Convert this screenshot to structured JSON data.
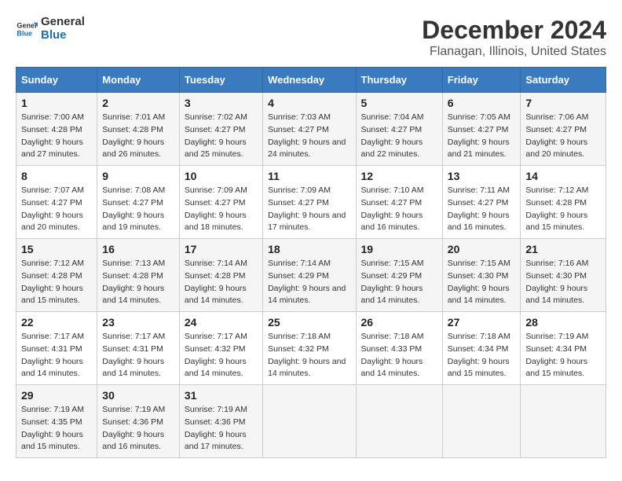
{
  "logo": {
    "line1": "General",
    "line2": "Blue"
  },
  "title": "December 2024",
  "subtitle": "Flanagan, Illinois, United States",
  "header_colors": {
    "bg": "#3a7abf",
    "text": "#ffffff"
  },
  "weekdays": [
    "Sunday",
    "Monday",
    "Tuesday",
    "Wednesday",
    "Thursday",
    "Friday",
    "Saturday"
  ],
  "weeks": [
    [
      {
        "day": "1",
        "sunrise": "Sunrise: 7:00 AM",
        "sunset": "Sunset: 4:28 PM",
        "daylight": "Daylight: 9 hours and 27 minutes."
      },
      {
        "day": "2",
        "sunrise": "Sunrise: 7:01 AM",
        "sunset": "Sunset: 4:28 PM",
        "daylight": "Daylight: 9 hours and 26 minutes."
      },
      {
        "day": "3",
        "sunrise": "Sunrise: 7:02 AM",
        "sunset": "Sunset: 4:27 PM",
        "daylight": "Daylight: 9 hours and 25 minutes."
      },
      {
        "day": "4",
        "sunrise": "Sunrise: 7:03 AM",
        "sunset": "Sunset: 4:27 PM",
        "daylight": "Daylight: 9 hours and 24 minutes."
      },
      {
        "day": "5",
        "sunrise": "Sunrise: 7:04 AM",
        "sunset": "Sunset: 4:27 PM",
        "daylight": "Daylight: 9 hours and 22 minutes."
      },
      {
        "day": "6",
        "sunrise": "Sunrise: 7:05 AM",
        "sunset": "Sunset: 4:27 PM",
        "daylight": "Daylight: 9 hours and 21 minutes."
      },
      {
        "day": "7",
        "sunrise": "Sunrise: 7:06 AM",
        "sunset": "Sunset: 4:27 PM",
        "daylight": "Daylight: 9 hours and 20 minutes."
      }
    ],
    [
      {
        "day": "8",
        "sunrise": "Sunrise: 7:07 AM",
        "sunset": "Sunset: 4:27 PM",
        "daylight": "Daylight: 9 hours and 20 minutes."
      },
      {
        "day": "9",
        "sunrise": "Sunrise: 7:08 AM",
        "sunset": "Sunset: 4:27 PM",
        "daylight": "Daylight: 9 hours and 19 minutes."
      },
      {
        "day": "10",
        "sunrise": "Sunrise: 7:09 AM",
        "sunset": "Sunset: 4:27 PM",
        "daylight": "Daylight: 9 hours and 18 minutes."
      },
      {
        "day": "11",
        "sunrise": "Sunrise: 7:09 AM",
        "sunset": "Sunset: 4:27 PM",
        "daylight": "Daylight: 9 hours and 17 minutes."
      },
      {
        "day": "12",
        "sunrise": "Sunrise: 7:10 AM",
        "sunset": "Sunset: 4:27 PM",
        "daylight": "Daylight: 9 hours and 16 minutes."
      },
      {
        "day": "13",
        "sunrise": "Sunrise: 7:11 AM",
        "sunset": "Sunset: 4:27 PM",
        "daylight": "Daylight: 9 hours and 16 minutes."
      },
      {
        "day": "14",
        "sunrise": "Sunrise: 7:12 AM",
        "sunset": "Sunset: 4:28 PM",
        "daylight": "Daylight: 9 hours and 15 minutes."
      }
    ],
    [
      {
        "day": "15",
        "sunrise": "Sunrise: 7:12 AM",
        "sunset": "Sunset: 4:28 PM",
        "daylight": "Daylight: 9 hours and 15 minutes."
      },
      {
        "day": "16",
        "sunrise": "Sunrise: 7:13 AM",
        "sunset": "Sunset: 4:28 PM",
        "daylight": "Daylight: 9 hours and 14 minutes."
      },
      {
        "day": "17",
        "sunrise": "Sunrise: 7:14 AM",
        "sunset": "Sunset: 4:28 PM",
        "daylight": "Daylight: 9 hours and 14 minutes."
      },
      {
        "day": "18",
        "sunrise": "Sunrise: 7:14 AM",
        "sunset": "Sunset: 4:29 PM",
        "daylight": "Daylight: 9 hours and 14 minutes."
      },
      {
        "day": "19",
        "sunrise": "Sunrise: 7:15 AM",
        "sunset": "Sunset: 4:29 PM",
        "daylight": "Daylight: 9 hours and 14 minutes."
      },
      {
        "day": "20",
        "sunrise": "Sunrise: 7:15 AM",
        "sunset": "Sunset: 4:30 PM",
        "daylight": "Daylight: 9 hours and 14 minutes."
      },
      {
        "day": "21",
        "sunrise": "Sunrise: 7:16 AM",
        "sunset": "Sunset: 4:30 PM",
        "daylight": "Daylight: 9 hours and 14 minutes."
      }
    ],
    [
      {
        "day": "22",
        "sunrise": "Sunrise: 7:17 AM",
        "sunset": "Sunset: 4:31 PM",
        "daylight": "Daylight: 9 hours and 14 minutes."
      },
      {
        "day": "23",
        "sunrise": "Sunrise: 7:17 AM",
        "sunset": "Sunset: 4:31 PM",
        "daylight": "Daylight: 9 hours and 14 minutes."
      },
      {
        "day": "24",
        "sunrise": "Sunrise: 7:17 AM",
        "sunset": "Sunset: 4:32 PM",
        "daylight": "Daylight: 9 hours and 14 minutes."
      },
      {
        "day": "25",
        "sunrise": "Sunrise: 7:18 AM",
        "sunset": "Sunset: 4:32 PM",
        "daylight": "Daylight: 9 hours and 14 minutes."
      },
      {
        "day": "26",
        "sunrise": "Sunrise: 7:18 AM",
        "sunset": "Sunset: 4:33 PM",
        "daylight": "Daylight: 9 hours and 14 minutes."
      },
      {
        "day": "27",
        "sunrise": "Sunrise: 7:18 AM",
        "sunset": "Sunset: 4:34 PM",
        "daylight": "Daylight: 9 hours and 15 minutes."
      },
      {
        "day": "28",
        "sunrise": "Sunrise: 7:19 AM",
        "sunset": "Sunset: 4:34 PM",
        "daylight": "Daylight: 9 hours and 15 minutes."
      }
    ],
    [
      {
        "day": "29",
        "sunrise": "Sunrise: 7:19 AM",
        "sunset": "Sunset: 4:35 PM",
        "daylight": "Daylight: 9 hours and 15 minutes."
      },
      {
        "day": "30",
        "sunrise": "Sunrise: 7:19 AM",
        "sunset": "Sunset: 4:36 PM",
        "daylight": "Daylight: 9 hours and 16 minutes."
      },
      {
        "day": "31",
        "sunrise": "Sunrise: 7:19 AM",
        "sunset": "Sunset: 4:36 PM",
        "daylight": "Daylight: 9 hours and 17 minutes."
      },
      null,
      null,
      null,
      null
    ]
  ]
}
